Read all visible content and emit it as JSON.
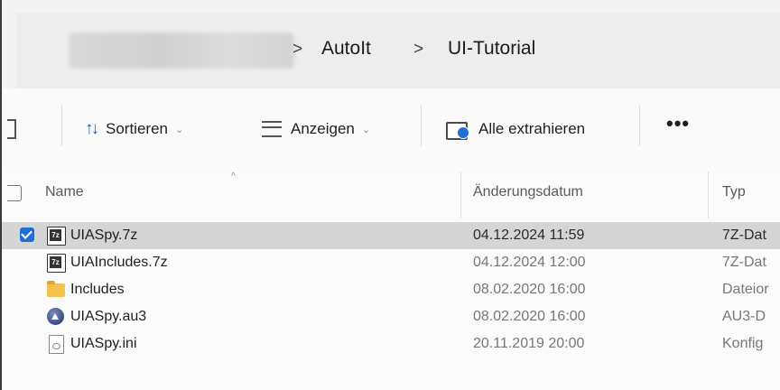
{
  "breadcrumb": {
    "separator": ">",
    "items": [
      "AutoIt",
      "UI-Tutorial"
    ]
  },
  "toolbar": {
    "sort_label": "Sortieren",
    "view_label": "Anzeigen",
    "extract_label": "Alle extrahieren",
    "more_label": "•••"
  },
  "columns": {
    "name": "Name",
    "date": "Änderungsdatum",
    "type": "Typ"
  },
  "files": [
    {
      "name": "UIASpy.7z",
      "date": "04.12.2024 11:59",
      "type": "7Z-Dat",
      "icon": "7z-archive-icon",
      "selected": true
    },
    {
      "name": "UIAIncludes.7z",
      "date": "04.12.2024 12:00",
      "type": "7Z-Dat",
      "icon": "7z-archive-icon",
      "selected": false
    },
    {
      "name": "Includes",
      "date": "08.02.2020 16:00",
      "type": "Dateior",
      "icon": "folder-icon",
      "selected": false
    },
    {
      "name": "UIASpy.au3",
      "date": "08.02.2020 16:00",
      "type": "AU3-D",
      "icon": "au3-script-icon",
      "selected": false
    },
    {
      "name": "UIASpy.ini",
      "date": "20.11.2019 20:00",
      "type": "Konfig",
      "icon": "ini-file-icon",
      "selected": false
    }
  ],
  "colors": {
    "accent": "#1f6fd6",
    "selected_row": "#d5d5d5",
    "folder": "#f2c14e"
  }
}
